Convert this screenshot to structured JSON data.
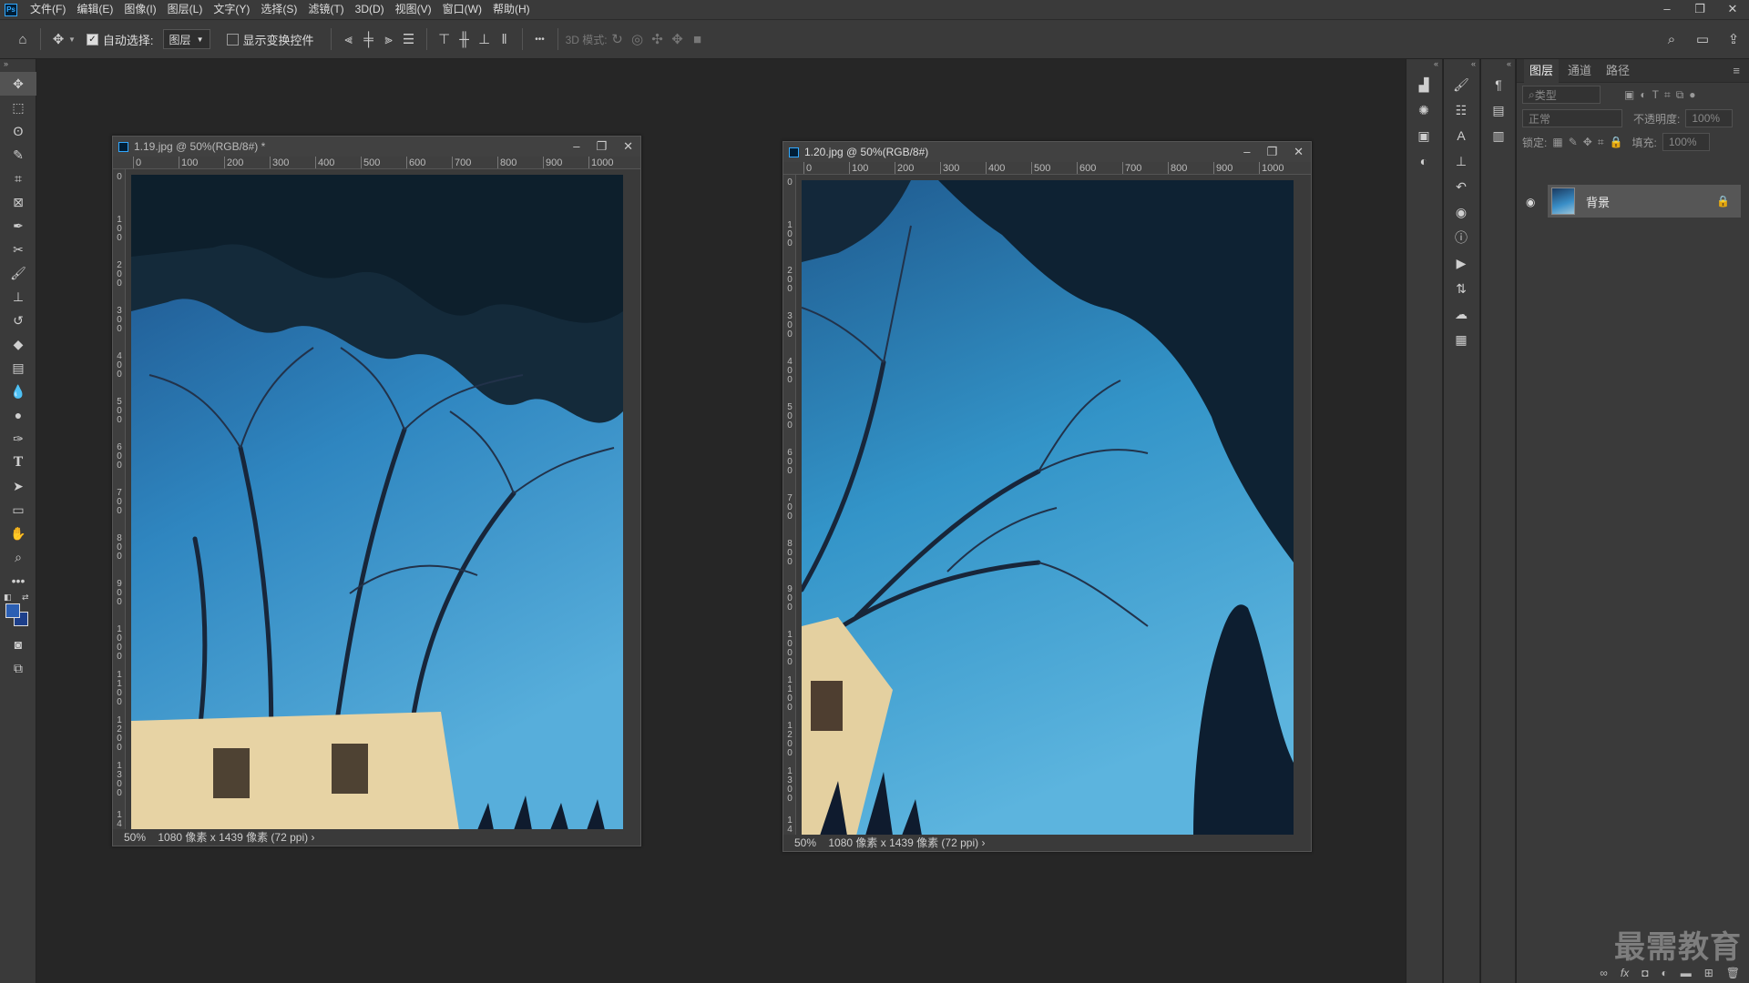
{
  "app": {
    "logo": "Ps"
  },
  "menu": [
    "文件(F)",
    "编辑(E)",
    "图像(I)",
    "图层(L)",
    "文字(Y)",
    "选择(S)",
    "滤镜(T)",
    "3D(D)",
    "视图(V)",
    "窗口(W)",
    "帮助(H)"
  ],
  "window_controls": {
    "minimize": "–",
    "restore": "❐",
    "close": "✕"
  },
  "options": {
    "auto_select_label": "自动选择:",
    "auto_select_checked": "✓",
    "auto_select_target": "图层",
    "show_transform_label": "显示变换控件",
    "mode_label": "3D 模式:",
    "more": "•••"
  },
  "doc1": {
    "title": "1.19.jpg @ 50%(RGB/8#) *",
    "zoom": "50%",
    "info": "1080 像素 x 1439 像素 (72 ppi)",
    "hticks": [
      "0",
      "100",
      "200",
      "300",
      "400",
      "500",
      "600",
      "700",
      "800",
      "900",
      "1000"
    ],
    "vticks": [
      "0",
      "100",
      "200",
      "300",
      "400",
      "500",
      "600",
      "700",
      "800",
      "900",
      "1000",
      "1100",
      "1200",
      "1300",
      "14"
    ]
  },
  "doc2": {
    "title": "1.20.jpg @ 50%(RGB/8#)",
    "zoom": "50%",
    "info": "1080 像素 x 1439 像素 (72 ppi)",
    "hticks": [
      "0",
      "100",
      "200",
      "300",
      "400",
      "500",
      "600",
      "700",
      "800",
      "900",
      "1000"
    ],
    "vticks": [
      "0",
      "100",
      "200",
      "300",
      "400",
      "500",
      "600",
      "700",
      "800",
      "900",
      "1000",
      "1100",
      "1200",
      "1300",
      "14"
    ]
  },
  "layers_panel": {
    "tabs": [
      "图层",
      "通道",
      "路径"
    ],
    "filter_placeholder": "类型",
    "blend_mode": "正常",
    "opacity_label": "不透明度:",
    "opacity_value": "100%",
    "lock_label": "锁定:",
    "fill_label": "填充:",
    "fill_value": "100%",
    "layer_name": "背景"
  },
  "watermark": "最需教育"
}
